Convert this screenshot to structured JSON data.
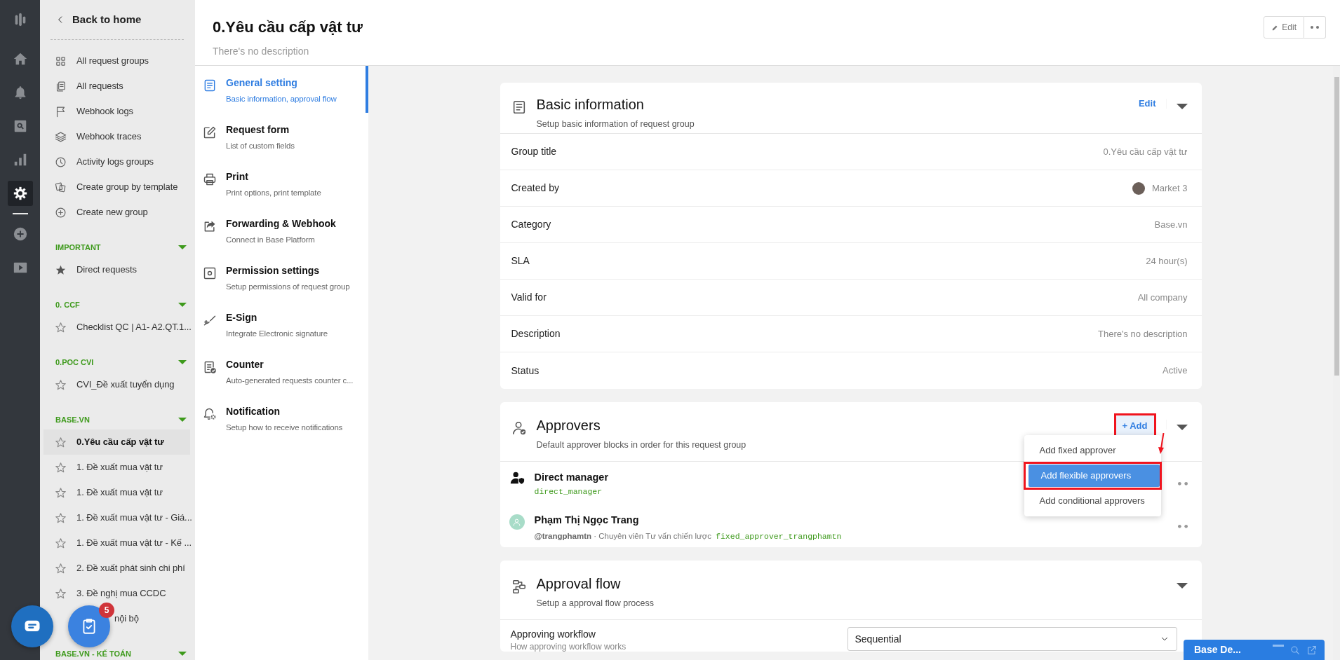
{
  "rail": {
    "top": [
      {
        "kind": "logo",
        "selected": false
      },
      {
        "kind": "home",
        "selected": false
      },
      {
        "kind": "bell",
        "selected": false
      },
      {
        "kind": "search",
        "selected": false
      },
      {
        "kind": "chart",
        "selected": false
      },
      {
        "kind": "settings",
        "selected": true
      }
    ],
    "bottom": [
      {
        "kind": "add",
        "selected": false
      },
      {
        "kind": "video",
        "selected": false
      }
    ]
  },
  "sidebar": {
    "back": "Back to home",
    "links": [
      {
        "kind": "grid",
        "label": "All request groups"
      },
      {
        "kind": "documents",
        "label": "All requests"
      },
      {
        "kind": "flag",
        "label": "Webhook logs"
      },
      {
        "kind": "layers",
        "label": "Webhook traces"
      },
      {
        "kind": "clock",
        "label": "Activity logs groups"
      },
      {
        "kind": "template",
        "label": "Create group by template"
      },
      {
        "kind": "add",
        "label": "Create new group"
      }
    ],
    "sections": [
      {
        "title": "IMPORTANT",
        "expanded": true,
        "items": [
          {
            "label": "Direct requests",
            "starred": true,
            "selected": false
          }
        ]
      },
      {
        "title": "0. CCF",
        "expanded": true,
        "items": [
          {
            "label": "Checklist QC | A1- A2.QT.1...",
            "starred": false,
            "selected": false
          }
        ]
      },
      {
        "title": "0.POC CVI",
        "expanded": true,
        "items": [
          {
            "label": "CVI_Đề xuất tuyển dụng",
            "starred": false,
            "selected": false
          }
        ]
      },
      {
        "title": "BASE.VN",
        "expanded": true,
        "items": [
          {
            "label": "0.Yêu cầu cấp vật tư",
            "starred": false,
            "selected": true
          },
          {
            "label": "1. Đề xuất mua vật tư",
            "starred": false,
            "selected": false
          },
          {
            "label": "1. Đề xuất mua vật tư",
            "starred": false,
            "selected": false
          },
          {
            "label": "1. Đề xuất mua vật tư - Giá...",
            "starred": false,
            "selected": false
          },
          {
            "label": "1. Đề xuất mua vật tư - Kế ...",
            "starred": false,
            "selected": false
          },
          {
            "label": "2. Đề xuất phát sinh chi phí",
            "starred": false,
            "selected": false
          },
          {
            "label": "3. Đề nghị mua CCDC",
            "starred": false,
            "selected": false
          },
          {
            "label": "nội bộ",
            "selected": false,
            "covered": true
          }
        ]
      },
      {
        "title": "BASE.VN - KẾ TOÁN",
        "expanded": true
      }
    ]
  },
  "floating": {
    "badge": "5"
  },
  "header": {
    "title": "0.Yêu cầu cấp vật tư",
    "description": "There's no description",
    "edit": "Edit"
  },
  "settings_nav": [
    {
      "kind": "general",
      "title": "General setting",
      "subtitle": "Basic information, approval flow",
      "selected": true
    },
    {
      "kind": "form",
      "title": "Request form",
      "subtitle": "List of custom fields",
      "selected": false
    },
    {
      "kind": "print",
      "title": "Print",
      "subtitle": "Print options, print template",
      "selected": false
    },
    {
      "kind": "forward",
      "title": "Forwarding & Webhook",
      "subtitle": "Connect in Base Platform",
      "selected": false
    },
    {
      "kind": "permission",
      "title": "Permission settings",
      "subtitle": "Setup permissions of request group",
      "selected": false
    },
    {
      "kind": "esign",
      "title": "E-Sign",
      "subtitle": "Integrate Electronic signature",
      "selected": false
    },
    {
      "kind": "counter",
      "title": "Counter",
      "subtitle": "Auto-generated requests counter c...",
      "selected": false
    },
    {
      "kind": "notification",
      "title": "Notification",
      "subtitle": "Setup how to receive notifications",
      "selected": false
    }
  ],
  "basic_info": {
    "title": "Basic information",
    "subtitle": "Setup basic information of request group",
    "edit": "Edit",
    "expanded": true,
    "rows": [
      {
        "kind": "text",
        "label": "Group title",
        "value": "0.Yêu cầu cấp vật tư"
      },
      {
        "kind": "user",
        "label": "Created by",
        "value": "Market 3"
      },
      {
        "kind": "text",
        "label": "Category",
        "value": "Base.vn"
      },
      {
        "kind": "text",
        "label": "SLA",
        "value": "24 hour(s)"
      },
      {
        "kind": "text",
        "label": "Valid for",
        "value": "All company"
      },
      {
        "kind": "text",
        "label": "Description",
        "value": "There's no description"
      },
      {
        "kind": "text",
        "label": "Status",
        "value": "Active"
      }
    ]
  },
  "approvers": {
    "title": "Approvers",
    "subtitle": "Default approver blocks in order for this request group",
    "expanded": true,
    "add": {
      "label": "+ Add",
      "highlighted": true
    },
    "menu": [
      {
        "label": "Add fixed approver",
        "selected": false,
        "highlighted": false
      },
      {
        "label": "Add flexible approvers",
        "selected": true,
        "highlighted": true
      },
      {
        "label": "Add conditional approvers",
        "selected": false,
        "highlighted": false
      }
    ],
    "arrow": true,
    "items": [
      {
        "kind": "role",
        "name": "Direct manager",
        "code": "direct_manager"
      },
      {
        "kind": "user",
        "name": "Phạm Thị Ngọc Trang",
        "meta": "**@trangphamtn** · Chuyên viên Tư vấn chiến lược",
        "code": "fixed_approver_trangphamtn"
      }
    ]
  },
  "approval_flow": {
    "title": "Approval flow",
    "subtitle": "Setup a approval flow process",
    "expanded": true,
    "fields": [
      {
        "label": "Approving workflow",
        "hint": "How approving workflow works",
        "value": "Sequential"
      }
    ]
  },
  "chat_widget": {
    "title": "Base De..."
  }
}
